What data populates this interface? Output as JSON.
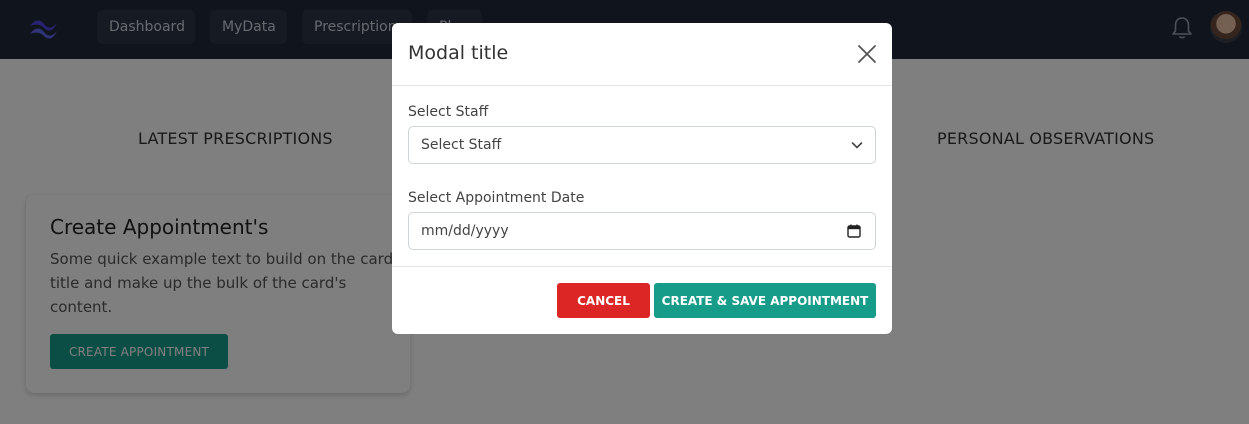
{
  "navbar": {
    "logo_icon": "tailwind-wave-logo",
    "items": [
      {
        "label": "Dashboard"
      },
      {
        "label": "MyData"
      },
      {
        "label": "Prescriptions"
      },
      {
        "label": "Pl..."
      }
    ],
    "notification_icon": "bell-icon",
    "avatar_icon": "user-avatar"
  },
  "main": {
    "sections": [
      {
        "title": "LATEST PRESCRIPTIONS"
      },
      {
        "title": "PERSONAL OBSERVATIONS"
      }
    ],
    "card": {
      "title": "Create Appointment's",
      "text": "Some quick example text to build on the card title and make up the bulk of the card's content.",
      "button_label": "CREATE APPOINTMENT"
    }
  },
  "modal": {
    "title": "Modal title",
    "close_icon": "close-icon",
    "staff": {
      "label": "Select Staff",
      "value": "Select Staff"
    },
    "date": {
      "label": "Select Appointment Date",
      "placeholder": "mm/dd/yyyy"
    },
    "cancel_label": "CANCEL",
    "save_label": "CREATE & SAVE APPOINTMENT"
  },
  "colors": {
    "navbar": "#202938",
    "primary": "#179c8a",
    "danger": "#dc2626"
  }
}
